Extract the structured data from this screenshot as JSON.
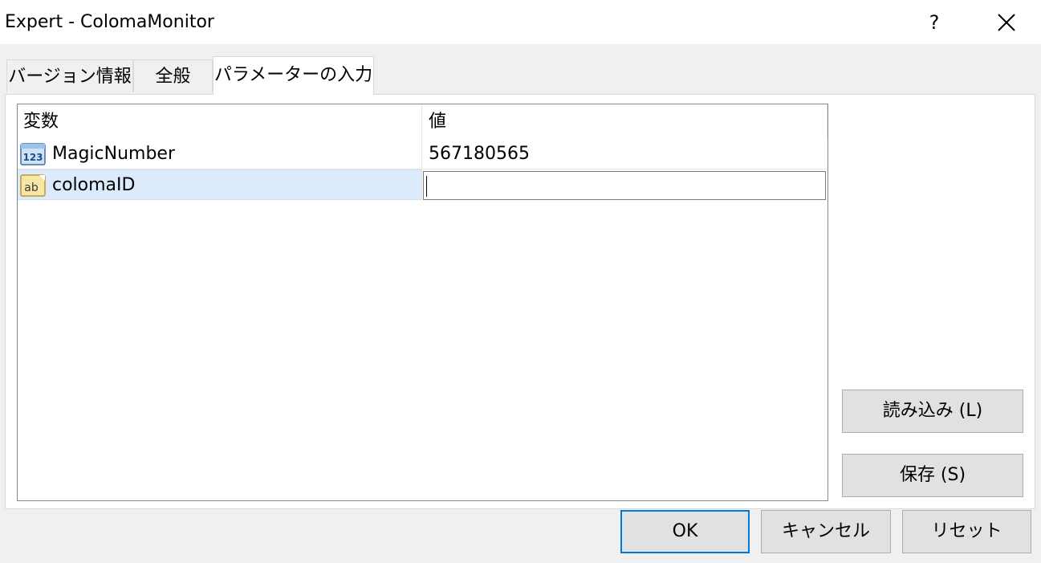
{
  "window": {
    "title": "Expert - ColomaMonitor",
    "help_label": "?",
    "close_icon": "close-icon"
  },
  "tabs": [
    {
      "label": "バージョン情報",
      "active": false
    },
    {
      "label": "全般",
      "active": false
    },
    {
      "label": "パラメーターの入力",
      "active": true
    }
  ],
  "grid": {
    "columns": [
      "変数",
      "値"
    ],
    "rows": [
      {
        "icon": "numeric-123-icon",
        "name": "MagicNumber",
        "value": "567180565"
      },
      {
        "icon": "string-ab-icon",
        "name": "colomaID",
        "value": ""
      }
    ]
  },
  "side_buttons": {
    "load": "読み込み (L)",
    "save": "保存 (S)"
  },
  "footer_buttons": {
    "ok": "OK",
    "cancel": "キャンセル",
    "reset": "リセット"
  },
  "colors": {
    "accent": "#0078d7",
    "selected_row": "#dcebfc"
  }
}
